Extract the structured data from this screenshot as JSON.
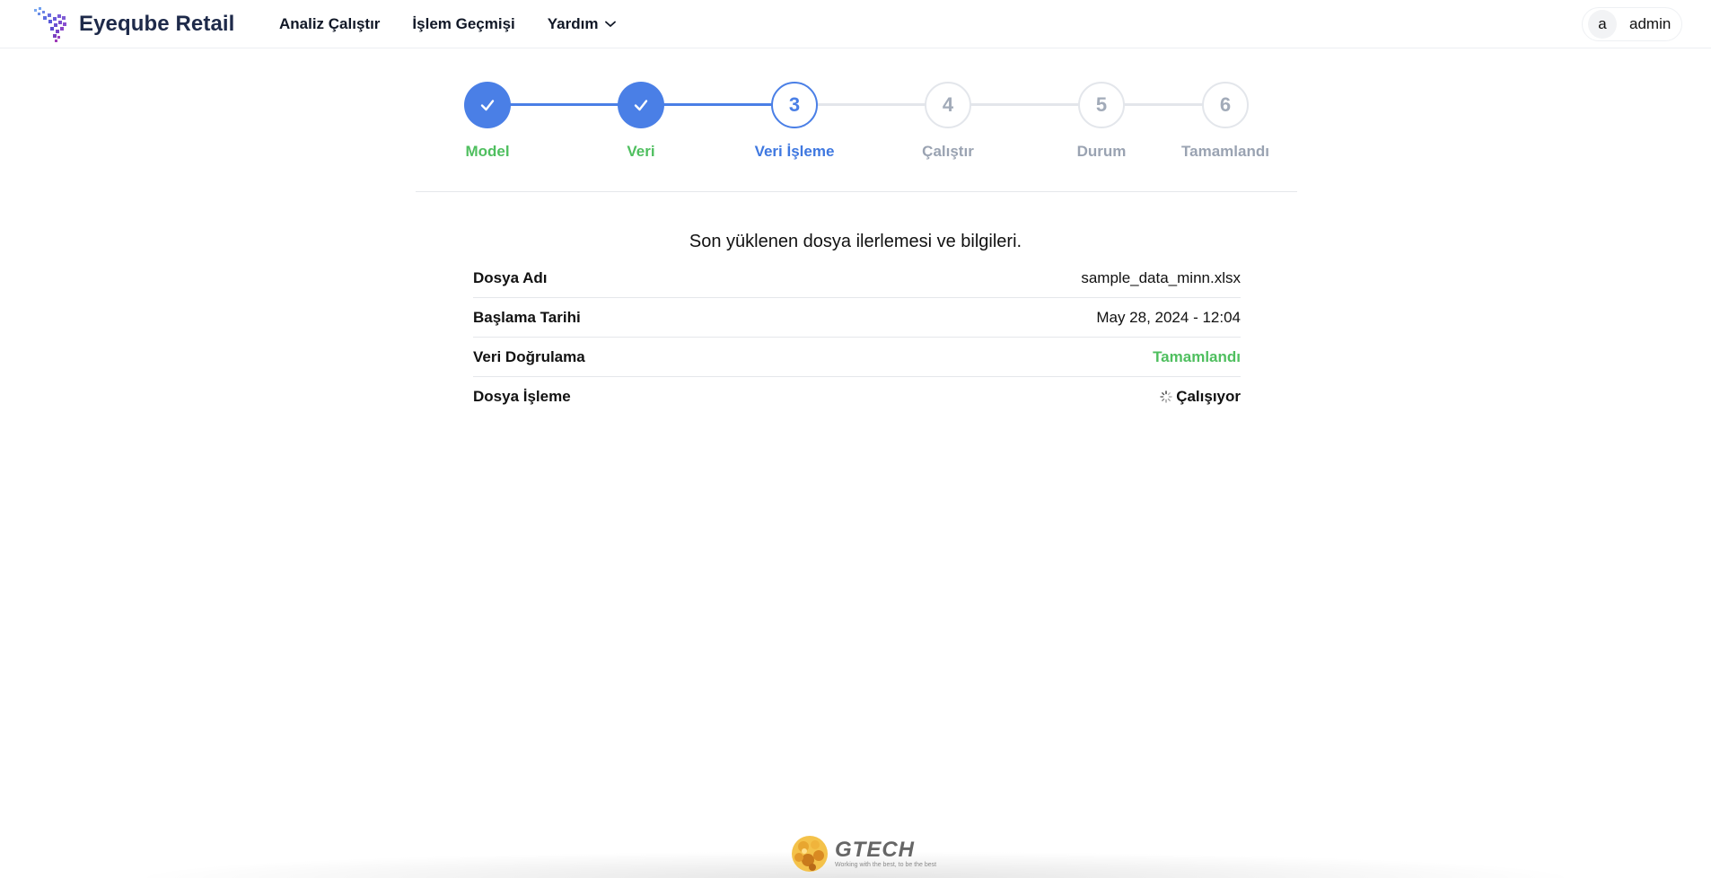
{
  "header": {
    "brand_name": "Eyeqube Retail",
    "nav": [
      {
        "label": "Analiz Çalıştır"
      },
      {
        "label": "İşlem Geçmişi"
      },
      {
        "label": "Yardım"
      }
    ],
    "user": {
      "initial": "a",
      "name": "admin"
    }
  },
  "stepper": {
    "steps": [
      {
        "number": "",
        "label": "Model",
        "state": "done"
      },
      {
        "number": "",
        "label": "Veri",
        "state": "done"
      },
      {
        "number": "3",
        "label": "Veri İşleme",
        "state": "active"
      },
      {
        "number": "4",
        "label": "Çalıştır",
        "state": "pending"
      },
      {
        "number": "5",
        "label": "Durum",
        "state": "pending"
      },
      {
        "number": "6",
        "label": "Tamamlandı",
        "state": "pending"
      }
    ]
  },
  "main": {
    "intro": "Son yüklenen dosya ilerlemesi ve bilgileri.",
    "rows": [
      {
        "key": "Dosya Adı",
        "value": "sample_data_minn.xlsx"
      },
      {
        "key": "Başlama Tarihi",
        "value": "May 28, 2024 - 12:04"
      },
      {
        "key": "Veri Doğrulama",
        "value": "Tamamlandı"
      },
      {
        "key": "Dosya İşleme",
        "value": "Çalışıyor"
      }
    ]
  },
  "footer": {
    "company": "GTECH",
    "slogan": "Working with the best, to be the best"
  },
  "colors": {
    "primary": "#4a7fe6",
    "success": "#4fbf5f",
    "pending": "#9aa3b2",
    "brand_text": "#1e2a4a"
  }
}
